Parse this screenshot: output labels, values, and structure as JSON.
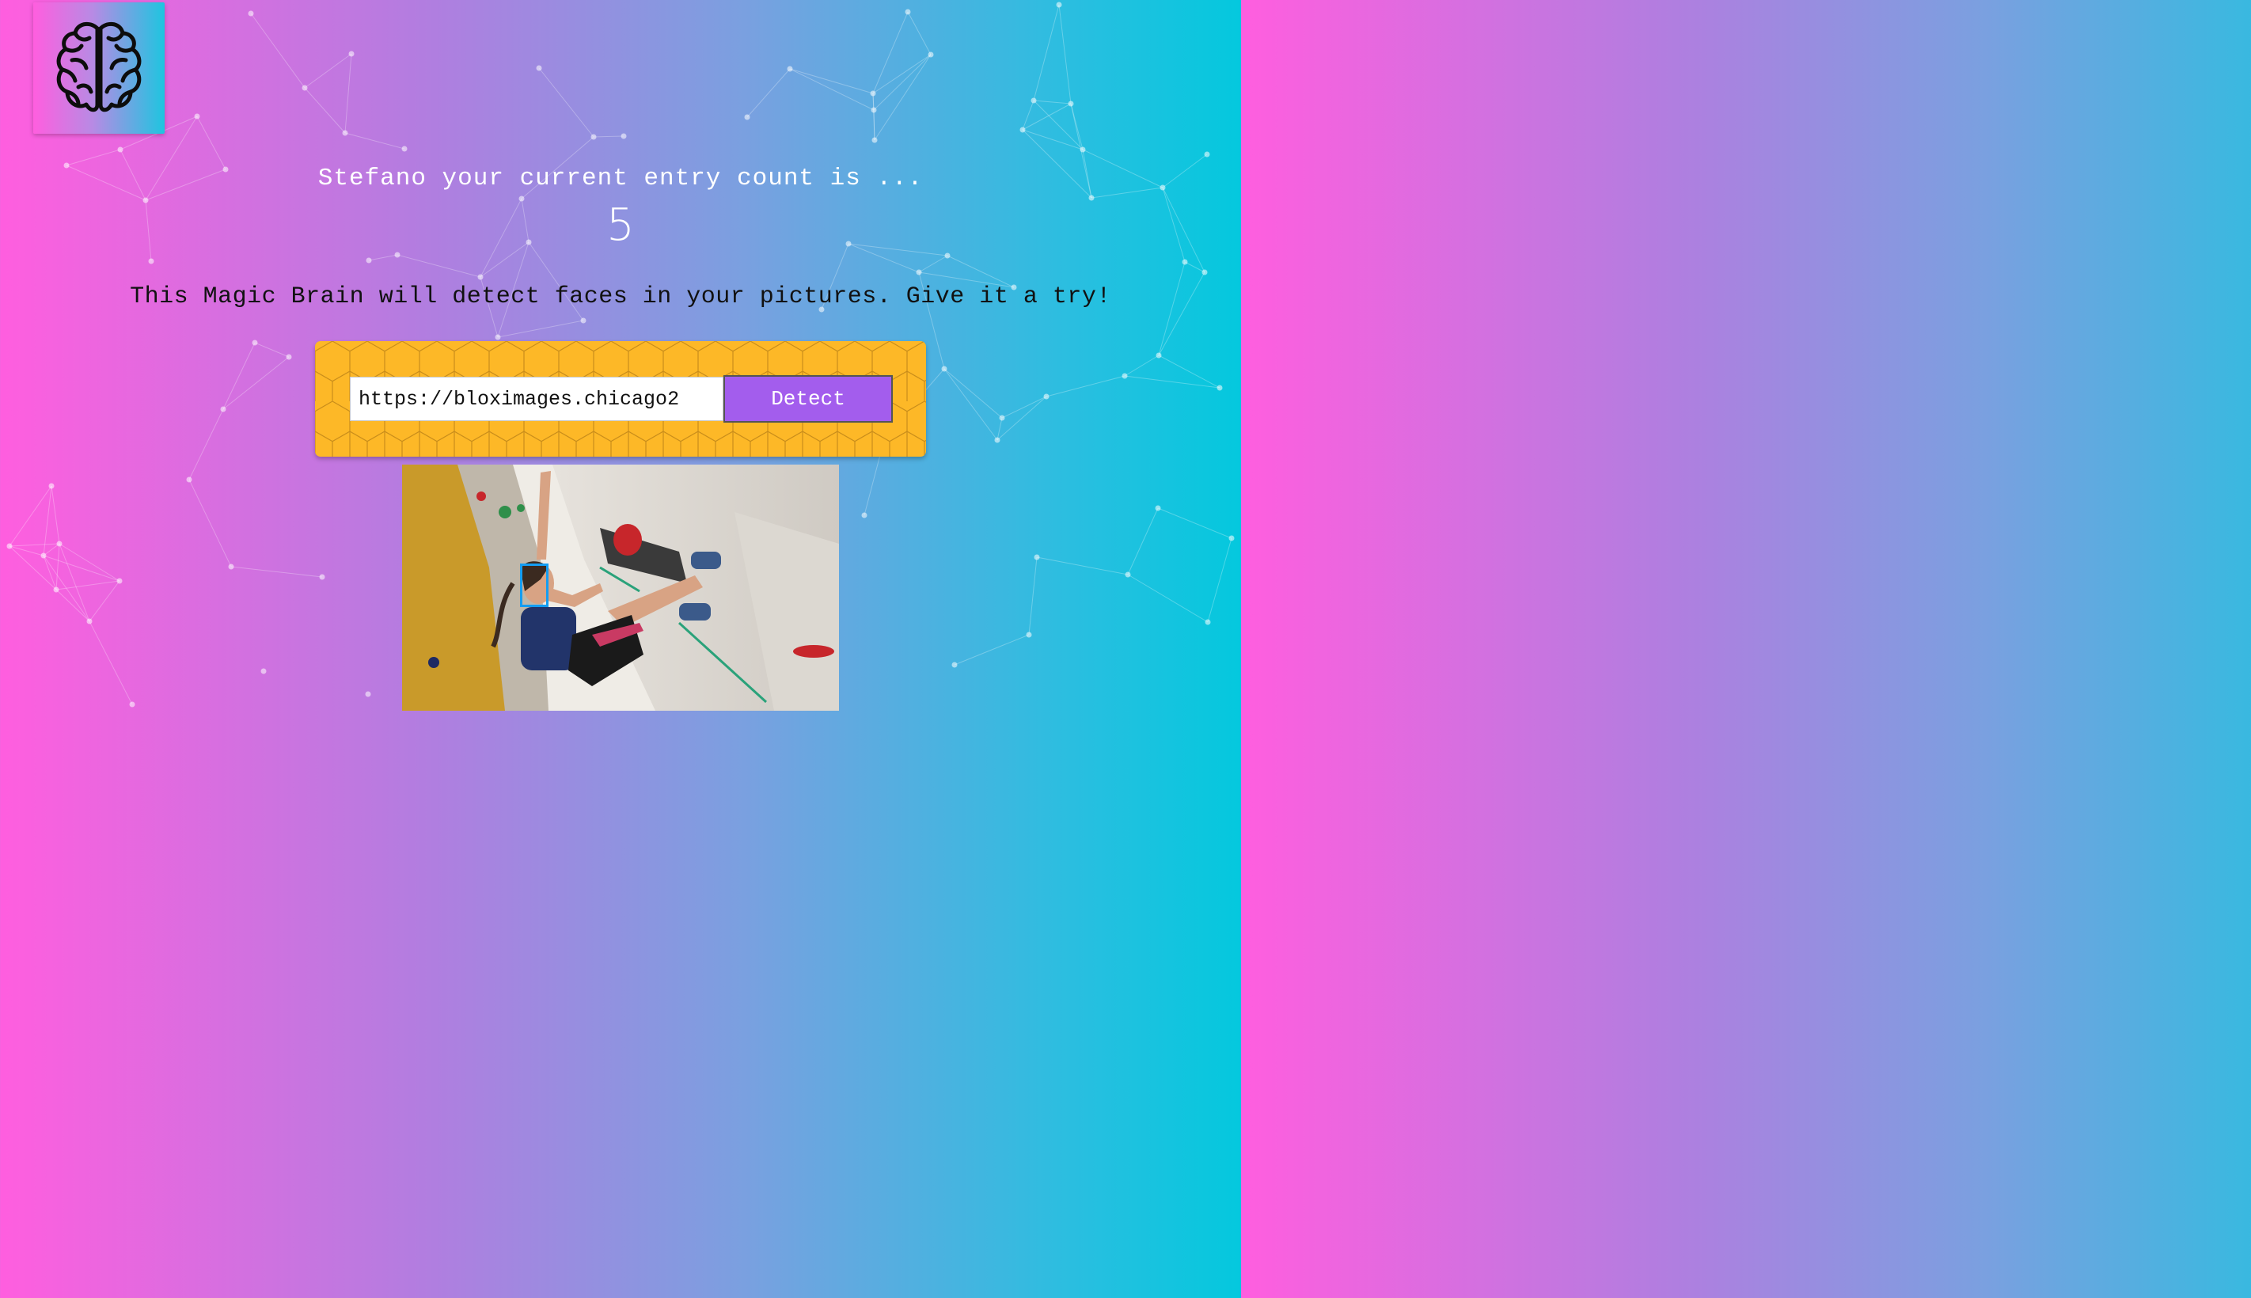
{
  "app": {
    "logo_icon": "brain-icon",
    "background_gradient": [
      "#ff5edf",
      "#04c8de"
    ]
  },
  "rank": {
    "entry_text": "Stefano your current entry count is ...",
    "count": "5"
  },
  "tagline": "This Magic Brain will detect faces in your pictures. Give it a try!",
  "form": {
    "url_value": "https://bloximages.chicago2",
    "detect_label": "Detect",
    "button_color": "#a35ded",
    "pattern_color": "#fdb827"
  },
  "result": {
    "image_subject": "climbing-wall-photo",
    "face_box_color": "#149df2",
    "faces_detected": 1
  }
}
